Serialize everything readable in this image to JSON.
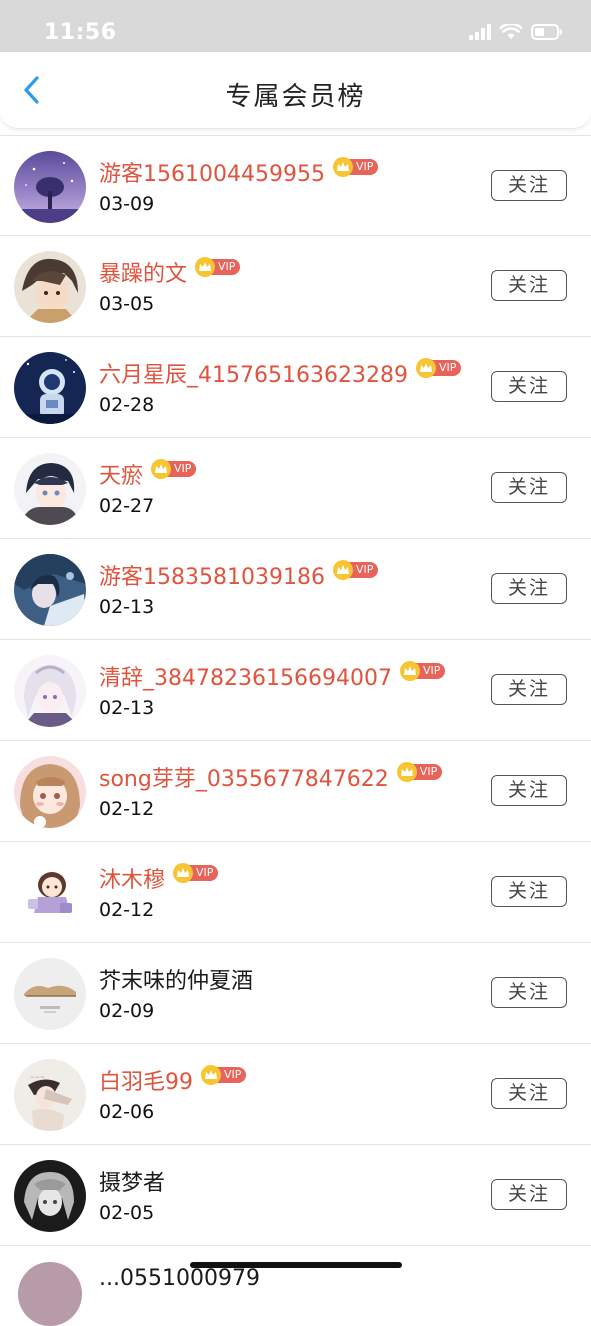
{
  "status_bar": {
    "time": "11:56"
  },
  "header": {
    "title": "专属会员榜"
  },
  "vip_badge_text": "VIP",
  "members": [
    {
      "name": "游客1561004459955",
      "date": "03-09",
      "vip": true,
      "follow_label": "关注",
      "avatar": "night-sky"
    },
    {
      "name": "暴躁的文",
      "date": "03-05",
      "vip": true,
      "follow_label": "关注",
      "avatar": "anime-boy-brown"
    },
    {
      "name": "六月星辰_415765163623289",
      "date": "02-28",
      "vip": true,
      "follow_label": "关注",
      "avatar": "astronaut-night"
    },
    {
      "name": "天瘀",
      "date": "02-27",
      "vip": true,
      "follow_label": "关注",
      "avatar": "anime-boy-hoodie"
    },
    {
      "name": "游客1583581039186",
      "date": "02-13",
      "vip": true,
      "follow_label": "关注",
      "avatar": "dark-blue-anime"
    },
    {
      "name": "清辞_38478236156694007",
      "date": "02-13",
      "vip": true,
      "follow_label": "关注",
      "avatar": "white-hair-anime"
    },
    {
      "name": "song芽芽_0355677847622",
      "date": "02-12",
      "vip": true,
      "follow_label": "关注",
      "avatar": "pink-girl"
    },
    {
      "name": "沐木穆",
      "date": "02-12",
      "vip": true,
      "follow_label": "关注",
      "avatar": "chibi-girl"
    },
    {
      "name": "芥末味的仲夏酒",
      "date": "02-09",
      "vip": false,
      "follow_label": "关注",
      "avatar": "sleeping-cat"
    },
    {
      "name": "白羽毛99",
      "date": "02-06",
      "vip": true,
      "follow_label": "关注",
      "avatar": "sketch-girl"
    },
    {
      "name": "摄梦者",
      "date": "02-05",
      "vip": false,
      "follow_label": "关注",
      "avatar": "gray-hair-dark"
    }
  ],
  "partial_member": {
    "name": "...0551000979"
  },
  "colors": {
    "vip_name": "#e0533c",
    "vip_pill": "#e8635a",
    "crown": "#f7c531",
    "back_arrow": "#2f9be6"
  }
}
